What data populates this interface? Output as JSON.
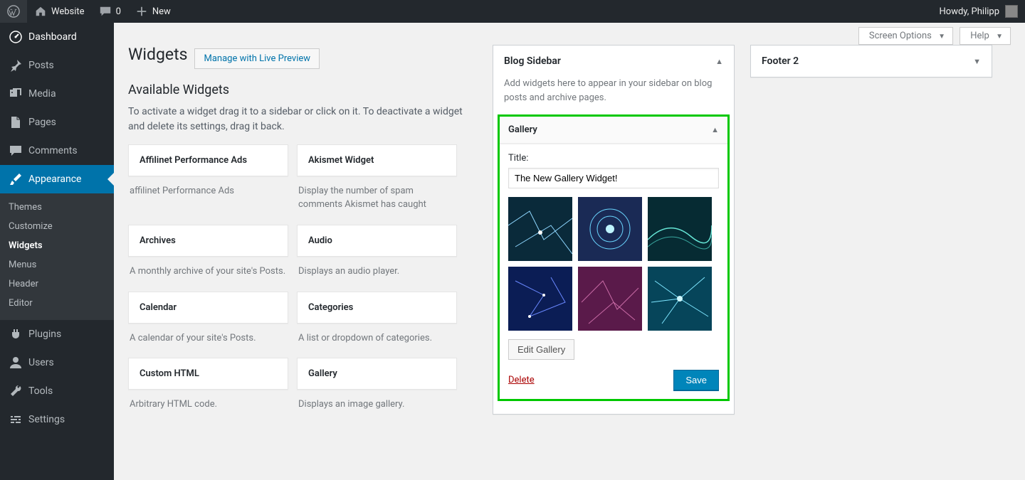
{
  "admin_bar": {
    "site_name": "Website",
    "comments_count": "0",
    "new_label": "New",
    "greeting": "Howdy, Philipp"
  },
  "sidebar": {
    "items": [
      {
        "label": "Dashboard"
      },
      {
        "label": "Posts"
      },
      {
        "label": "Media"
      },
      {
        "label": "Pages"
      },
      {
        "label": "Comments"
      },
      {
        "label": "Appearance"
      },
      {
        "label": "Plugins"
      },
      {
        "label": "Users"
      },
      {
        "label": "Tools"
      },
      {
        "label": "Settings"
      }
    ],
    "appearance_sub": [
      {
        "label": "Themes"
      },
      {
        "label": "Customize"
      },
      {
        "label": "Widgets"
      },
      {
        "label": "Menus"
      },
      {
        "label": "Header"
      },
      {
        "label": "Editor"
      }
    ]
  },
  "topright": {
    "screen_options": "Screen Options",
    "help": "Help"
  },
  "title": "Widgets",
  "live_preview_label": "Manage with Live Preview",
  "available": {
    "heading": "Available Widgets",
    "help": "To activate a widget drag it to a sidebar or click on it. To deactivate a widget and delete its settings, drag it back.",
    "widgets": [
      {
        "name": "Affilinet Performance Ads",
        "desc": "affilinet Performance Ads"
      },
      {
        "name": "Akismet Widget",
        "desc": "Display the number of spam comments Akismet has caught"
      },
      {
        "name": "Archives",
        "desc": "A monthly archive of your site's Posts."
      },
      {
        "name": "Audio",
        "desc": "Displays an audio player."
      },
      {
        "name": "Calendar",
        "desc": "A calendar of your site's Posts."
      },
      {
        "name": "Categories",
        "desc": "A list or dropdown of catego­ries."
      },
      {
        "name": "Custom HTML",
        "desc": "Arbitrary HTML code."
      },
      {
        "name": "Gallery",
        "desc": "Displays an image gallery."
      }
    ]
  },
  "blog_sidebar": {
    "title": "Blog Sidebar",
    "desc": "Add widgets here to appear in your sidebar on blog posts and archive pages.",
    "gallery_widget": {
      "title": "Gallery",
      "title_field_label": "Title:",
      "title_value": "The New Gallery Widget!",
      "edit_label": "Edit Gallery",
      "delete_label": "Delete",
      "save_label": "Save"
    }
  },
  "footer2": {
    "title": "Footer 2"
  }
}
